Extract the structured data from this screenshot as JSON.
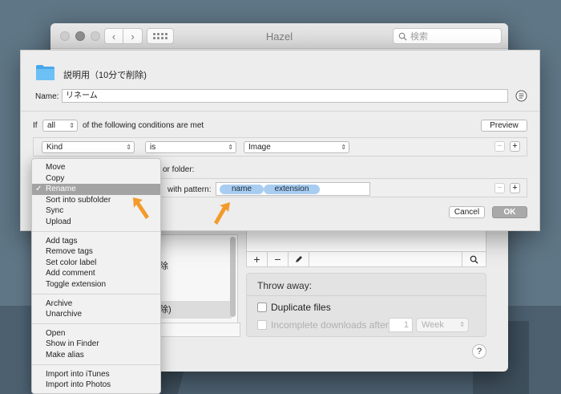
{
  "window": {
    "title": "Hazel",
    "search_placeholder": "検索"
  },
  "sheet": {
    "folder_name": "説明用（10分で削除)",
    "name_label": "Name:",
    "name_value": "リネーム",
    "if_label": "If",
    "match_mode": "all",
    "conditions_text": "of the following conditions are met",
    "preview_label": "Preview",
    "condition": {
      "attribute": "Kind",
      "operator": "is",
      "value": "Image"
    },
    "action_text_folder": "or folder:",
    "action_text_pattern": "with pattern:",
    "tokens": [
      "name",
      "extension"
    ],
    "cancel_label": "Cancel",
    "ok_label": "OK"
  },
  "menu": {
    "groups": [
      [
        "Move",
        "Copy",
        "Rename",
        "Sort into subfolder",
        "Sync",
        "Upload"
      ],
      [
        "Add tags",
        "Remove tags",
        "Set color label",
        "Add comment",
        "Toggle extension"
      ],
      [
        "Archive",
        "Unarchive"
      ],
      [
        "Open",
        "Show in Finder",
        "Make alias"
      ],
      [
        "Import into iTunes",
        "Import into Photos"
      ]
    ],
    "selected": "Rename"
  },
  "background": {
    "list_partial_1": "除",
    "list_partial_2": "除)",
    "throw_away_title": "Throw away:",
    "duplicate_files": "Duplicate files",
    "incomplete_downloads": "Incomplete downloads after",
    "incomplete_value": "1",
    "incomplete_unit": "Week",
    "help": "?"
  },
  "colors": {
    "token_blue": "#a9cdf1",
    "arrow_orange": "#f39a2a",
    "folder_blue": "#5bb4f2"
  }
}
